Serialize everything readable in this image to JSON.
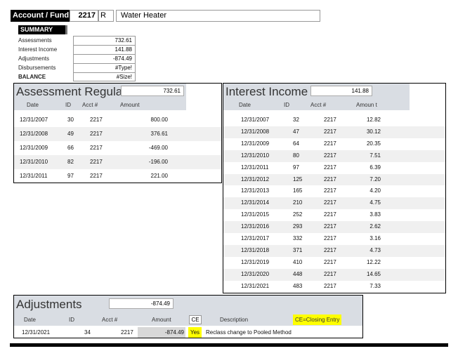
{
  "header": {
    "account_label": "Account / Fund",
    "account_number": "2217",
    "account_code": "R",
    "account_name": "Water Heater"
  },
  "summary": {
    "title": "SUMMARY",
    "rows": [
      {
        "label": "Assessments",
        "value": "732.61"
      },
      {
        "label": "Interest Income",
        "value": "141.88"
      },
      {
        "label": "Adjustments",
        "value": "-874.49"
      },
      {
        "label": "Disbursements",
        "value": "#Type!"
      },
      {
        "label": "BALANCE",
        "value": "#Size!"
      }
    ]
  },
  "assessment": {
    "title": "Assessment Regular",
    "total": "732.61",
    "columns": [
      "Date",
      "ID",
      "Acct #",
      "Amount"
    ],
    "rows": [
      {
        "date": "12/31/2007",
        "id": "30",
        "acct": "2217",
        "amount": "800.00"
      },
      {
        "date": "12/31/2008",
        "id": "49",
        "acct": "2217",
        "amount": "376.61"
      },
      {
        "date": "12/31/2009",
        "id": "66",
        "acct": "2217",
        "amount": "-469.00"
      },
      {
        "date": "12/31/2010",
        "id": "82",
        "acct": "2217",
        "amount": "-196.00"
      },
      {
        "date": "12/31/2011",
        "id": "97",
        "acct": "2217",
        "amount": "221.00"
      }
    ]
  },
  "interest": {
    "title": "Interest Income",
    "total": "141.88",
    "columns": [
      "Date",
      "ID",
      "Acct #",
      "Amoun t"
    ],
    "rows": [
      {
        "date": "12/31/2007",
        "id": "32",
        "acct": "2217",
        "amount": "12.82"
      },
      {
        "date": "12/31/2008",
        "id": "47",
        "acct": "2217",
        "amount": "30.12"
      },
      {
        "date": "12/31/2009",
        "id": "64",
        "acct": "2217",
        "amount": "20.35"
      },
      {
        "date": "12/31/2010",
        "id": "80",
        "acct": "2217",
        "amount": "7.51"
      },
      {
        "date": "12/31/2011",
        "id": "97",
        "acct": "2217",
        "amount": "6.39"
      },
      {
        "date": "12/31/2012",
        "id": "125",
        "acct": "2217",
        "amount": "7.20"
      },
      {
        "date": "12/31/2013",
        "id": "165",
        "acct": "2217",
        "amount": "4.20"
      },
      {
        "date": "12/31/2014",
        "id": "210",
        "acct": "2217",
        "amount": "4.75"
      },
      {
        "date": "12/31/2015",
        "id": "252",
        "acct": "2217",
        "amount": "3.83"
      },
      {
        "date": "12/31/2016",
        "id": "293",
        "acct": "2217",
        "amount": "2.62"
      },
      {
        "date": "12/31/2017",
        "id": "332",
        "acct": "2217",
        "amount": "3.16"
      },
      {
        "date": "12/31/2018",
        "id": "371",
        "acct": "2217",
        "amount": "4.73"
      },
      {
        "date": "12/31/2019",
        "id": "410",
        "acct": "2217",
        "amount": "12.22"
      },
      {
        "date": "12/31/2020",
        "id": "448",
        "acct": "2217",
        "amount": "14.65"
      },
      {
        "date": "12/31/2021",
        "id": "483",
        "acct": "2217",
        "amount": "7.33"
      }
    ]
  },
  "adjustments": {
    "title": "Adjustments",
    "total": "-874.49",
    "columns": [
      "Date",
      "ID",
      "Acct #",
      "Amount",
      "CE",
      "Description",
      "CE=Closing Entry"
    ],
    "rows": [
      {
        "date": "12/31/2021",
        "id": "34",
        "acct": "2217",
        "amount": "-874.49",
        "ce": "Yes",
        "description": "Reclass change to Pooled Method"
      }
    ]
  },
  "colors": {
    "panel_header": "#d9dde3",
    "highlight": "#ffff00",
    "amount_grey": "#d8d8d8"
  }
}
